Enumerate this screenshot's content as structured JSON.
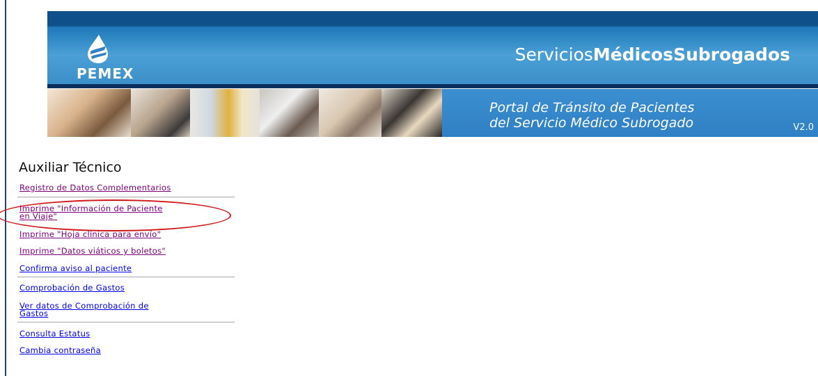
{
  "header": {
    "logo_text": "PEMEX",
    "site_title_part1": "Servicios",
    "site_title_part2": "Médicos",
    "site_title_part3": "Subrogados",
    "portal_line1": "Portal de Tránsito de Pacientes",
    "portal_line2": "del Servicio Médico Subrogado",
    "version": "V2.0"
  },
  "menu": {
    "title": "Auxiliar Técnico",
    "items": [
      {
        "label": "Registro de Datos Complementarios"
      },
      {
        "label_line1": "Imprime \"Información de Paciente",
        "label_line2": "en Viaje\""
      },
      {
        "label": "Imprime \"Hoja clínica para envío\""
      },
      {
        "label": "Imprime \"Datos viáticos y boletos\""
      },
      {
        "label": "Confirma aviso al paciente"
      },
      {
        "label": "Comprobación de Gastos"
      },
      {
        "label_line1": "Ver datos de Comprobación de",
        "label_line2": "Gastos"
      },
      {
        "label": "Consulta Estatus"
      },
      {
        "label": "Cambia contraseña"
      }
    ]
  },
  "colors": {
    "link": "#0000ff",
    "visited_link": "#800080",
    "highlight_ellipse": "#d01818",
    "banner_blue": "#2f80c4"
  }
}
